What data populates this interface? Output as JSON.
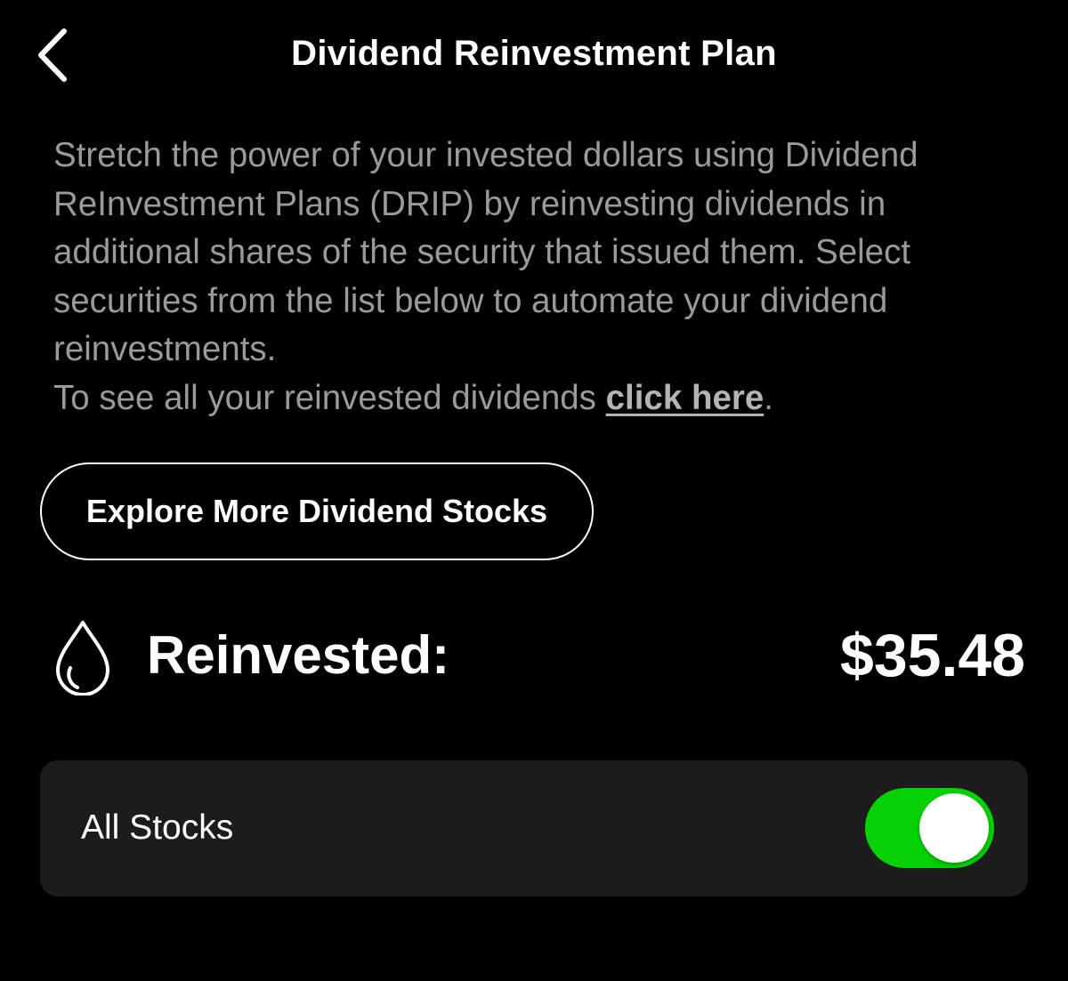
{
  "header": {
    "back_icon": "chevron-left-icon",
    "title": "Dividend Reinvestment Plan"
  },
  "description": {
    "text": "Stretch the power of your invested dollars using Dividend ReInvestment Plans (DRIP) by reinvesting dividends in additional shares of the security that issued them. Select securities from the list below to automate your dividend reinvestments.",
    "line2_prefix": "To see all your reinvested dividends ",
    "link_label": "click here",
    "line2_suffix": "."
  },
  "explore_button": {
    "label": "Explore More Dividend Stocks"
  },
  "reinvested": {
    "icon": "droplet-icon",
    "label": "Reinvested:",
    "value": "$35.48"
  },
  "all_stocks": {
    "label": "All Stocks",
    "toggle_on": true,
    "toggle_color": "#05d105"
  },
  "colors": {
    "background": "#000000",
    "card": "#1c1c1c",
    "secondary_text": "#9a9a9a"
  }
}
